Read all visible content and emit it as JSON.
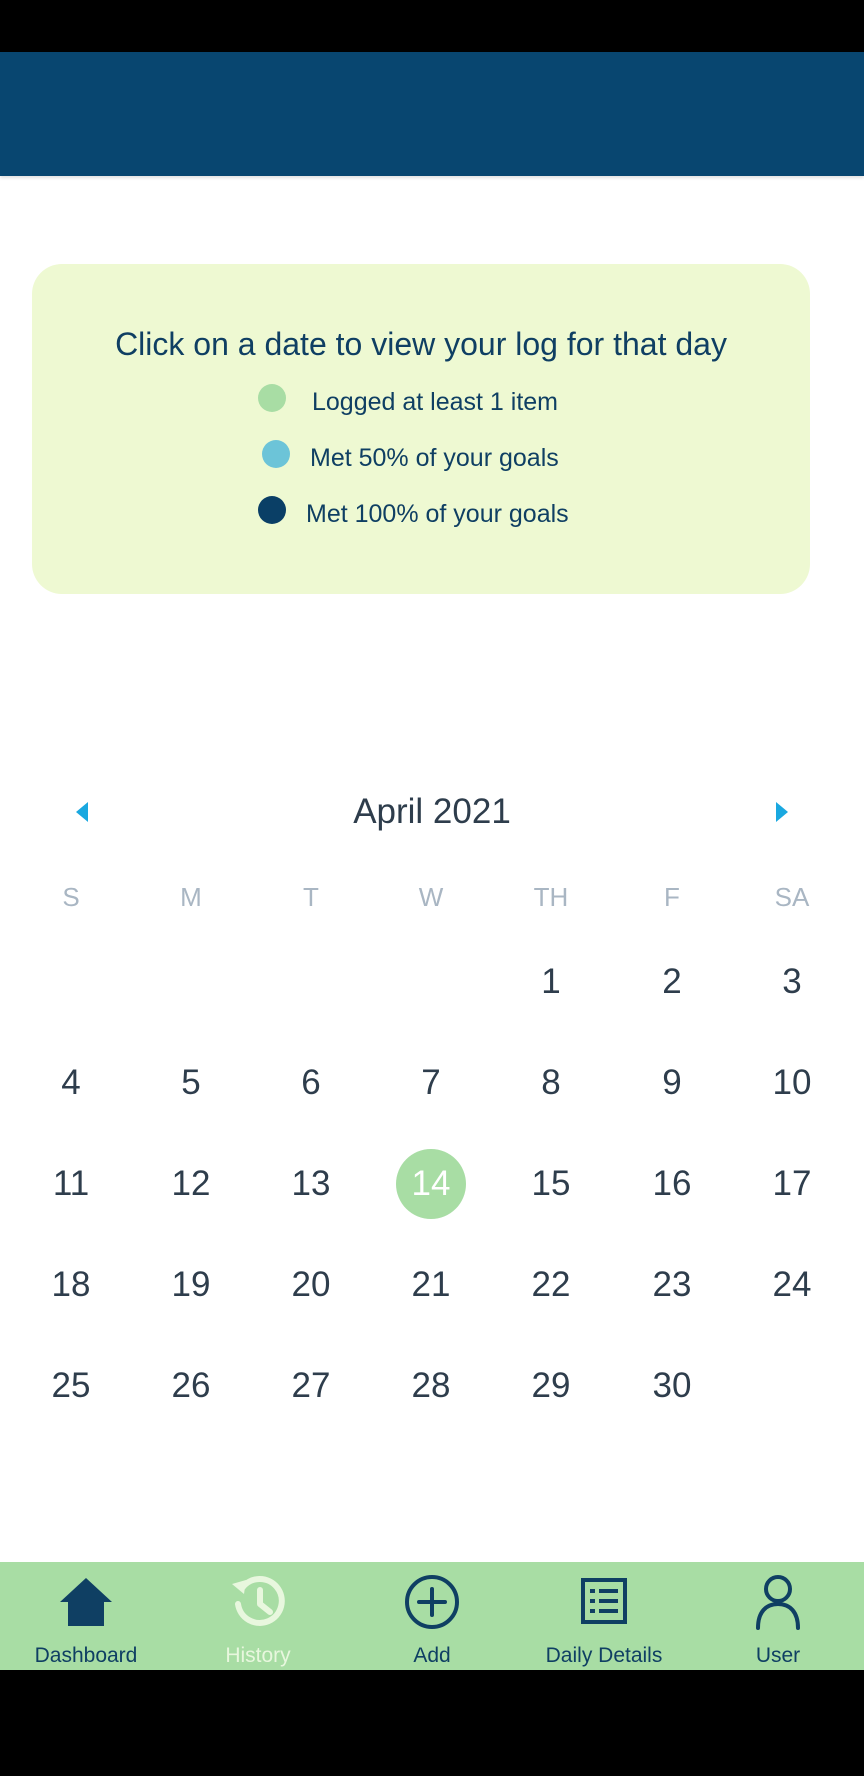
{
  "info_card": {
    "title": "Click on a date to view your log for that day",
    "legend": [
      {
        "label": "Logged at least 1 item",
        "color": "#a8dda4"
      },
      {
        "label": "Met 50% of your goals",
        "color": "#6cc4d8"
      },
      {
        "label": "Met 100% of your goals",
        "color": "#0a3f66"
      }
    ]
  },
  "calendar": {
    "month_title": "April 2021",
    "weekdays": [
      "S",
      "M",
      "T",
      "W",
      "TH",
      "F",
      "SA"
    ],
    "selected_day": "14",
    "weeks": [
      [
        "",
        "",
        "",
        "",
        "1",
        "2",
        "3"
      ],
      [
        "4",
        "5",
        "6",
        "7",
        "8",
        "9",
        "10"
      ],
      [
        "11",
        "12",
        "13",
        "14",
        "15",
        "16",
        "17"
      ],
      [
        "18",
        "19",
        "20",
        "21",
        "22",
        "23",
        "24"
      ],
      [
        "25",
        "26",
        "27",
        "28",
        "29",
        "30",
        ""
      ]
    ]
  },
  "tabs": [
    {
      "label": "Dashboard",
      "icon": "home-icon"
    },
    {
      "label": "History",
      "icon": "history-icon",
      "active": true
    },
    {
      "label": "Add",
      "icon": "add-circle-icon"
    },
    {
      "label": "Daily Details",
      "icon": "list-icon"
    },
    {
      "label": "User",
      "icon": "user-icon"
    }
  ],
  "colors": {
    "header": "#084670",
    "card_bg": "#eef9d2",
    "accent_arrow": "#1aa8e0",
    "tab_bar": "#a8dda4",
    "selected_day": "#a8dda4"
  }
}
